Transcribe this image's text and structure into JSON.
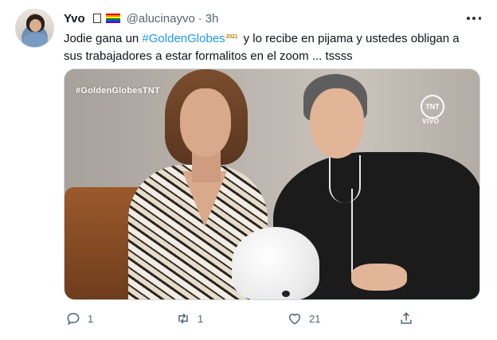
{
  "user": {
    "name": "Yvo",
    "handle": "@alucinayvo",
    "separator": "·",
    "time": "3h"
  },
  "tweet": {
    "text_before": "Jodie gana un ",
    "hashtag": "#GoldenGlobes",
    "badge": "2021",
    "text_after": " y lo recibe en pijama y ustedes obligan a sus trabajadores a estar formalitos en el zoom ... tssss"
  },
  "media": {
    "overlay_hashtag": "#GoldenGlobesTNT",
    "network_logo": "TNT",
    "network_sub": "VIVO"
  },
  "actions": {
    "reply_count": "1",
    "retweet_count": "1",
    "like_count": "21"
  },
  "icons": {
    "more": "more-icon",
    "reply": "reply-icon",
    "retweet": "retweet-icon",
    "like": "heart-icon",
    "share": "share-icon"
  },
  "colors": {
    "link": "#1d9bf0",
    "secondary_text": "#536471"
  }
}
